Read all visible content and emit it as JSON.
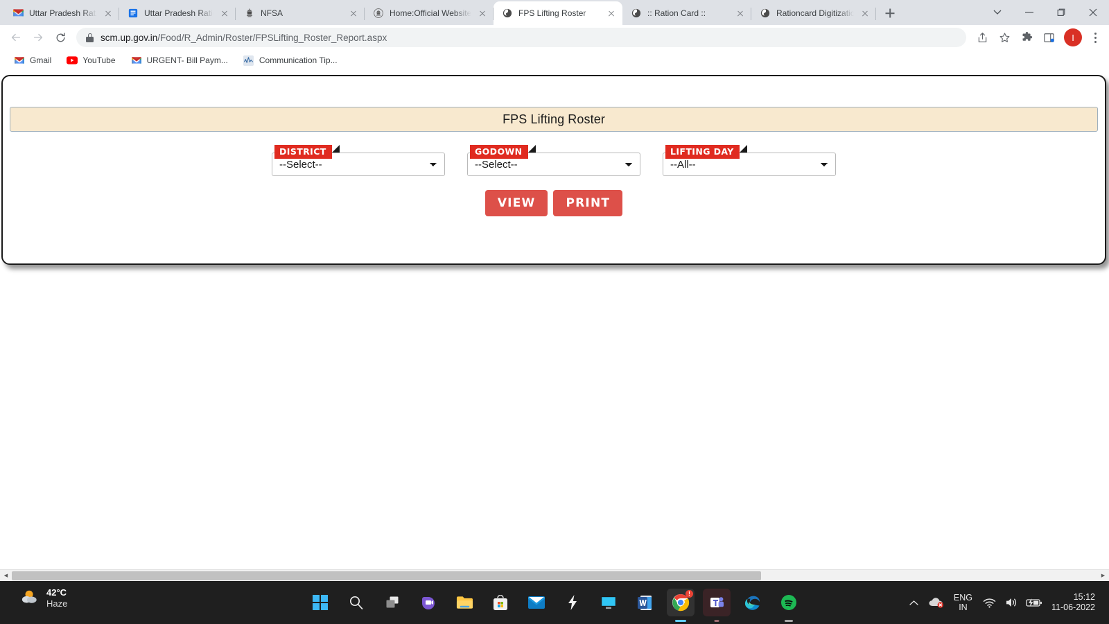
{
  "browser": {
    "tabs": [
      {
        "title": "Uttar Pradesh Rat... -",
        "favicon": "gmail-icon",
        "active": false
      },
      {
        "title": "Uttar Pradesh Ration",
        "favicon": "document-icon",
        "active": false
      },
      {
        "title": "NFSA",
        "favicon": "emblem-icon",
        "active": false
      },
      {
        "title": "Home:Official Website",
        "favicon": "emblem-icon",
        "active": false
      },
      {
        "title": "FPS Lifting Roster",
        "favicon": "globe-icon",
        "active": true
      },
      {
        "title": ":: Ration Card ::",
        "favicon": "globe-icon",
        "active": false
      },
      {
        "title": "Rationcard Digitizatio",
        "favicon": "globe-icon",
        "active": false
      }
    ],
    "new_tab_label": "+",
    "window_controls": {
      "tab_search": "chevron-down-icon",
      "minimize": "minimize-icon",
      "maximize": "maximize-icon",
      "close": "close-icon"
    },
    "nav": {
      "back": "back-arrow-icon",
      "forward": "forward-arrow-icon",
      "reload": "reload-icon"
    },
    "omnibox": {
      "lock": "lock-icon",
      "url_domain": "scm.up.gov.in",
      "url_path": "/Food/R_Admin/Roster/FPSLifting_Roster_Report.aspx"
    },
    "toolbar_icons": [
      {
        "name": "share-icon"
      },
      {
        "name": "bookmark-star-icon"
      },
      {
        "name": "extensions-puzzle-icon"
      },
      {
        "name": "side-panel-icon"
      }
    ],
    "profile_initial": "I",
    "menu": "kebab-menu-icon",
    "bookmarks": [
      {
        "label": "Gmail",
        "icon": "gmail-icon"
      },
      {
        "label": "YouTube",
        "icon": "youtube-icon"
      },
      {
        "label": "URGENT- Bill Paym...",
        "icon": "gmail-icon"
      },
      {
        "label": "Communication Tip...",
        "icon": "analytics-icon"
      }
    ]
  },
  "page": {
    "title": "FPS Lifting Roster",
    "filters": [
      {
        "ribbon": "DISTRICT",
        "value": "--Select--",
        "options": [
          "--Select--"
        ]
      },
      {
        "ribbon": "GODOWN",
        "value": "--Select--",
        "options": [
          "--Select--"
        ]
      },
      {
        "ribbon": "LIFTING DAY",
        "value": "--All--",
        "options": [
          "--All--"
        ]
      }
    ],
    "buttons": {
      "view": "VIEW",
      "print": "PRINT"
    }
  },
  "taskbar": {
    "weather": {
      "temperature": "42°C",
      "condition": "Haze",
      "icon": "sun-cloud-icon"
    },
    "apps": [
      {
        "name": "start-button-icon"
      },
      {
        "name": "search-icon"
      },
      {
        "name": "task-view-icon"
      },
      {
        "name": "chat-teams-icon"
      },
      {
        "name": "file-explorer-icon"
      },
      {
        "name": "microsoft-store-icon"
      },
      {
        "name": "mail-icon"
      },
      {
        "name": "app-shortcut-icon"
      },
      {
        "name": "remote-desktop-icon"
      },
      {
        "name": "word-icon"
      },
      {
        "name": "chrome-icon"
      },
      {
        "name": "teams-icon"
      },
      {
        "name": "edge-icon"
      },
      {
        "name": "spotify-icon"
      }
    ],
    "tray": {
      "overflow": "chevron-up-icon",
      "onedrive": "onedrive-error-icon",
      "language_primary": "ENG",
      "language_secondary": "IN",
      "wifi": "wifi-icon",
      "volume": "volume-icon",
      "battery": "battery-charging-icon",
      "time": "15:12",
      "date": "11-06-2022"
    }
  }
}
